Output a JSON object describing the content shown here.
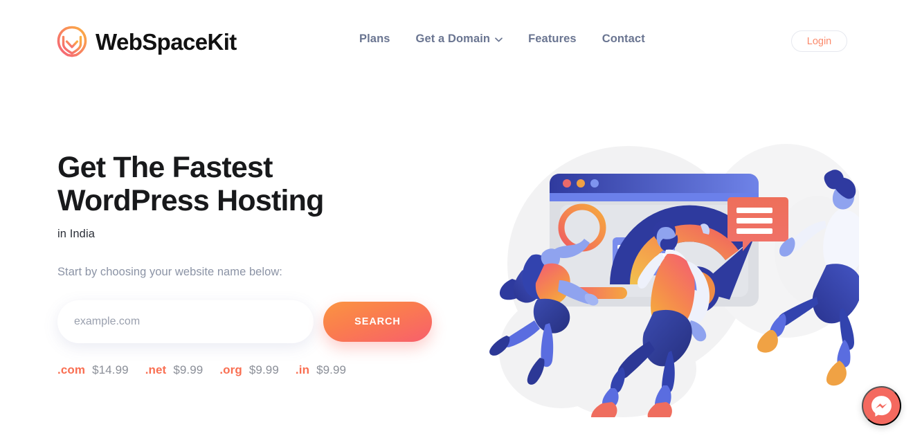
{
  "brand": {
    "name": "WebSpaceKit",
    "logo_icon": "webspacekit-circular-logo-icon",
    "logo_gradient_from": "#f4607a",
    "logo_gradient_to": "#fbb040"
  },
  "nav": {
    "items": [
      {
        "label": "Plans",
        "has_dropdown": false
      },
      {
        "label": "Get a Domain",
        "has_dropdown": true,
        "icon": "chevron-down-icon"
      },
      {
        "label": "Features",
        "has_dropdown": false
      },
      {
        "label": "Contact",
        "has_dropdown": false
      }
    ],
    "text_color": "#6a7591"
  },
  "login": {
    "label": "Login",
    "text_color": "#fb8a6b",
    "border_color": "#e6e8ef"
  },
  "hero": {
    "headline": "Get The Fastest\nWordPress Hosting",
    "subheadline": "in India",
    "lede": "Start by choosing your website name below:",
    "search": {
      "placeholder": "example.com",
      "value": "",
      "button_label": "SEARCH",
      "button_gradient_from": "#fb9442",
      "button_gradient_to": "#f85f6c"
    },
    "tlds": [
      {
        "name": ".com",
        "price": "$14.99"
      },
      {
        "name": ".net",
        "price": "$9.99"
      },
      {
        "name": ".org",
        "price": "$9.99"
      },
      {
        "name": ".in",
        "price": "$9.99"
      }
    ],
    "tld_name_color": "#f96f52",
    "tld_price_color": "#8b8f98",
    "illustration": "hosting-speed-illustration"
  },
  "chat_widget": {
    "icon": "facebook-messenger-icon",
    "background_color": "#f4695f"
  }
}
